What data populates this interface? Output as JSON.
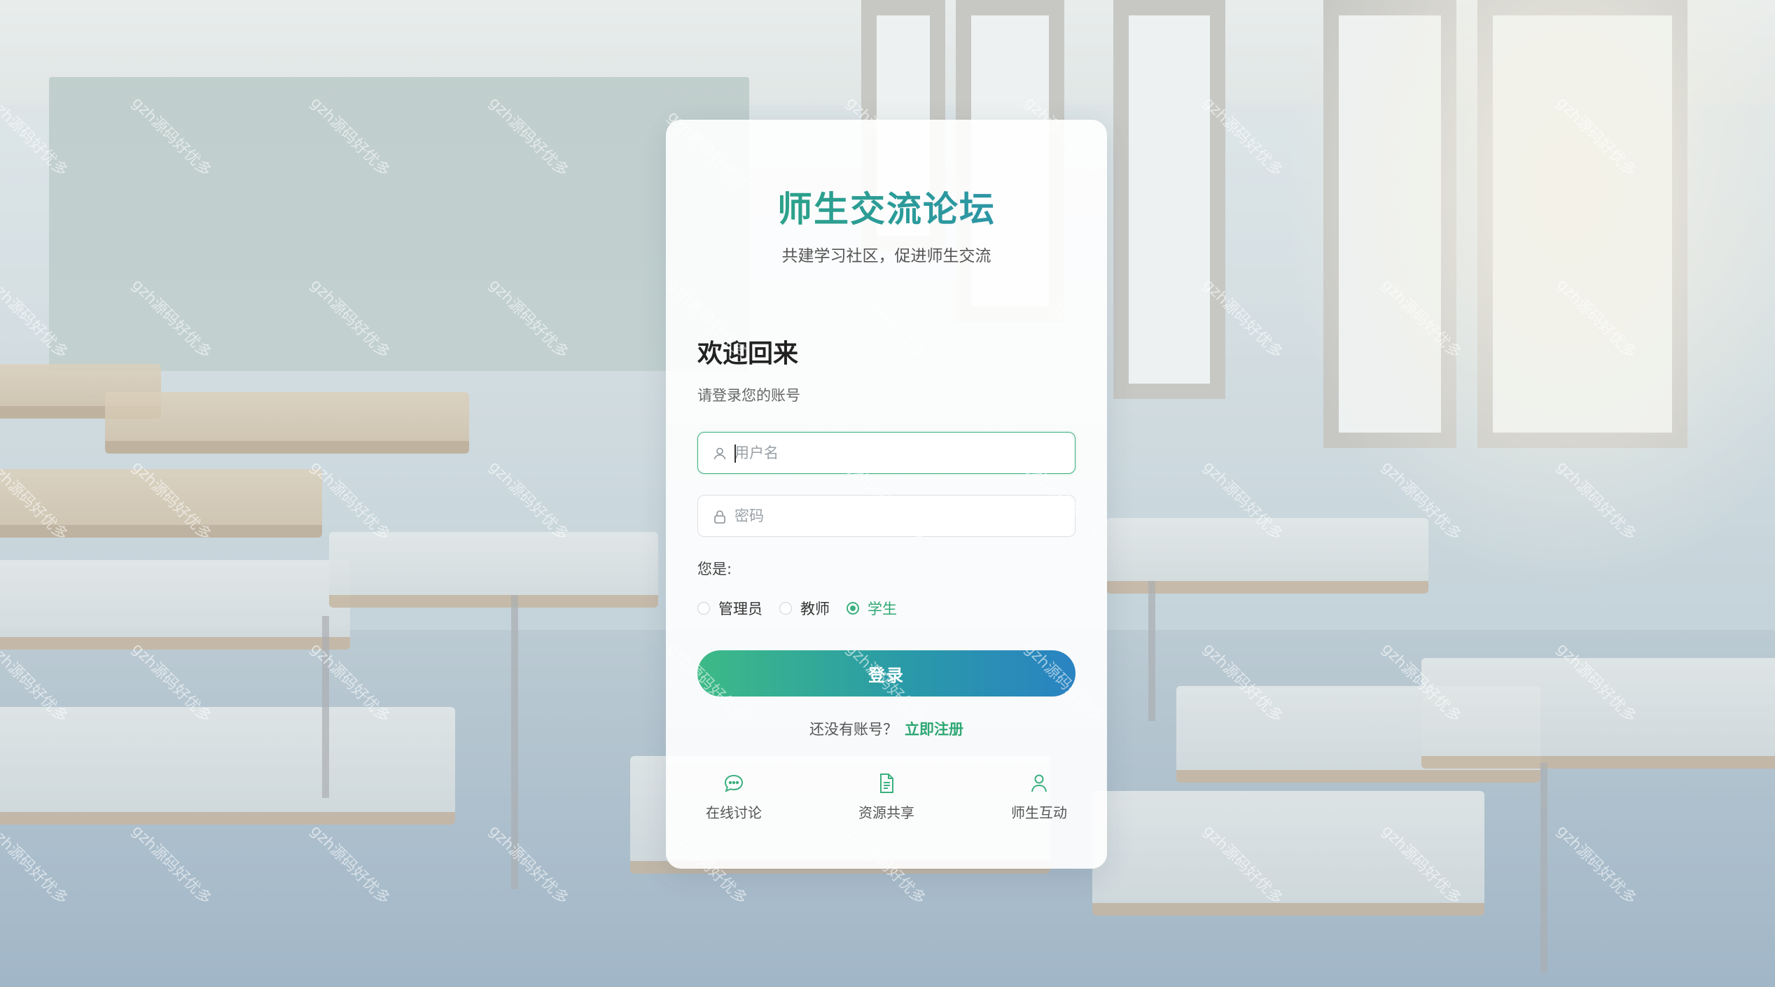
{
  "brand": {
    "title": "师生交流论坛",
    "subtitle": "共建学习社区，促进师生交流"
  },
  "login": {
    "heading": "欢迎回来",
    "subheading": "请登录您的账号",
    "username": {
      "placeholder": "用户名",
      "value": "",
      "icon": "user-icon"
    },
    "password": {
      "placeholder": "密码",
      "value": "",
      "icon": "lock-icon"
    },
    "role_label": "您是:",
    "roles": [
      {
        "label": "管理员",
        "checked": false
      },
      {
        "label": "教师",
        "checked": false
      },
      {
        "label": "学生",
        "checked": true
      }
    ],
    "submit_label": "登录",
    "register_prompt": "还没有账号？",
    "register_link": "立即注册"
  },
  "features": [
    {
      "label": "在线讨论",
      "icon": "chat-bubble-icon"
    },
    {
      "label": "资源共享",
      "icon": "document-icon"
    },
    {
      "label": "师生互动",
      "icon": "person-icon"
    }
  ],
  "watermark": {
    "text": "gzh源码好优多"
  },
  "colors": {
    "accent_green": "#3bb07e",
    "accent_blue": "#2a83c2",
    "checked_label": "#2fa874"
  }
}
